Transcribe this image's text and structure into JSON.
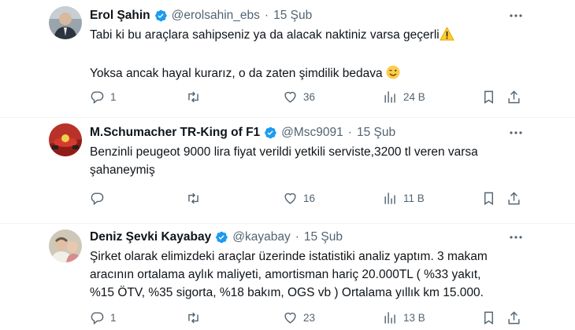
{
  "tweets": [
    {
      "name": "Erol Şahin",
      "handle": "@erolsahin_ebs",
      "date": "15 Şub",
      "text_line1": "Tabi ki bu araçlara sahipseniz ya da alacak naktiniz varsa  geçerli",
      "text_line2": "Yoksa ancak hayal kurarız, o da zaten şimdilik bedava",
      "replies": "1",
      "retweets": "",
      "likes": "36",
      "views": "24 B"
    },
    {
      "name": "M.Schumacher TR-King of F1",
      "handle": "@Msc9091",
      "date": "15 Şub",
      "text": "Benzinli peugeot 9000 lira fiyat verildi yetkili serviste,3200 tl veren varsa\nşahaneymiş",
      "replies": "",
      "retweets": "",
      "likes": "16",
      "views": "11 B"
    },
    {
      "name": "Deniz Şevki Kayabay",
      "handle": "@kayabay",
      "date": "15 Şub",
      "text": "Şirket olarak elimizdeki araçlar üzerinde istatistiki analiz yaptım. 3 makam\naracının ortalama aylık maliyeti, amortisman hariç 20.000TL ( %33 yakıt,\n%15 ÖTV, %35 sigorta, %18 bakım, OGS vb ) Ortalama yıllık km 15.000.",
      "replies": "1",
      "retweets": "",
      "likes": "23",
      "views": "13 B"
    }
  ],
  "colors": {
    "text": "#0f1419",
    "secondary": "#536471",
    "verified": "#1d9bf0",
    "divider": "#eff3f4"
  },
  "separator": "·"
}
